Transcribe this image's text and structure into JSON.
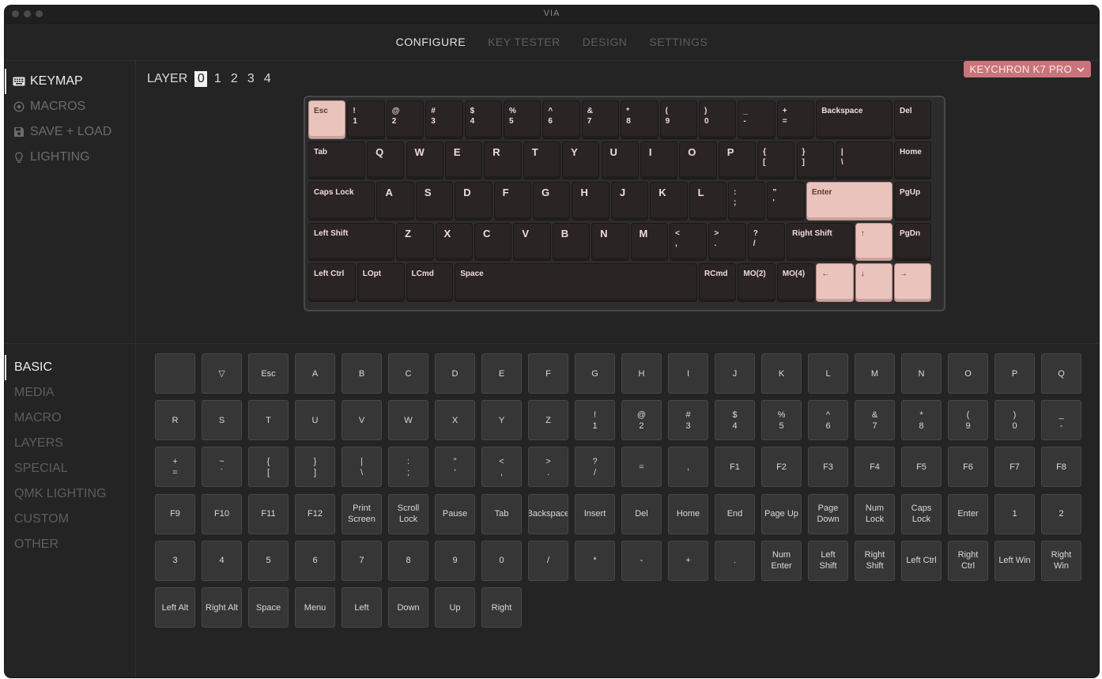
{
  "window": {
    "title": "VIA"
  },
  "nav": {
    "tabs": [
      "CONFIGURE",
      "KEY TESTER",
      "DESIGN",
      "SETTINGS"
    ],
    "active": 0
  },
  "sidebar": {
    "menu": [
      {
        "label": "KEYMAP",
        "icon": "keyboard-icon",
        "active": true
      },
      {
        "label": "MACROS",
        "icon": "circle-dot-icon",
        "active": false
      },
      {
        "label": "SAVE + LOAD",
        "icon": "floppy-icon",
        "active": false
      },
      {
        "label": "LIGHTING",
        "icon": "bulb-icon",
        "active": false
      }
    ],
    "categories": [
      "BASIC",
      "MEDIA",
      "MACRO",
      "LAYERS",
      "SPECIAL",
      "QMK LIGHTING",
      "CUSTOM",
      "OTHER"
    ]
  },
  "layers": {
    "label": "LAYER",
    "items": [
      "0",
      "1",
      "2",
      "3",
      "4"
    ],
    "active": 0
  },
  "keyboard_select": {
    "label": "KEYCHRON K7 PRO"
  },
  "colors": {
    "accent": "#c9747a",
    "keycap": "#2a2424",
    "keycap_accent": "#e9c3bc"
  },
  "keyboard": {
    "rows": [
      [
        "Esc",
        "!\n1",
        "@\n2",
        "#\n3",
        "$\n4",
        "%\n5",
        "^\n6",
        "&\n7",
        "*\n8",
        "(\n9",
        ")\n0",
        "_\n-",
        "+\n=",
        "Backspace",
        "Del"
      ],
      [
        "Tab",
        "Q",
        "W",
        "E",
        "R",
        "T",
        "Y",
        "U",
        "I",
        "O",
        "P",
        "{\n[",
        "}\n]",
        "|\n\\",
        "Home"
      ],
      [
        "Caps Lock",
        "A",
        "S",
        "D",
        "F",
        "G",
        "H",
        "J",
        "K",
        "L",
        ":\n;",
        "\"\n'",
        "Enter",
        "PgUp"
      ],
      [
        "Left Shift",
        "Z",
        "X",
        "C",
        "V",
        "B",
        "N",
        "M",
        "<\n,",
        ">\n.",
        "?\n/",
        "Right Shift",
        "↑",
        "PgDn"
      ],
      [
        "Left Ctrl",
        "LOpt",
        "LCmd",
        "Space",
        "RCmd",
        "MO(2)",
        "MO(4)",
        "←",
        "↓",
        "→"
      ]
    ]
  },
  "picker": {
    "keys": [
      "",
      "▽",
      "Esc",
      "A",
      "B",
      "C",
      "D",
      "E",
      "F",
      "G",
      "H",
      "I",
      "J",
      "K",
      "L",
      "M",
      "N",
      "O",
      "P",
      "Q",
      "R",
      "S",
      "T",
      "U",
      "V",
      "W",
      "X",
      "Y",
      "Z",
      "!\n1",
      "@\n2",
      "#\n3",
      "$\n4",
      "%\n5",
      "^\n6",
      "&\n7",
      "*\n8",
      "(\n9",
      ")\n0",
      "_\n-",
      "+\n=",
      "~\n`",
      "{\n[",
      "}\n]",
      "|\n\\",
      ":\n;",
      "\"\n'",
      "<\n,",
      ">\n.",
      "?\n/",
      "=",
      ",",
      "F1",
      "F2",
      "F3",
      "F4",
      "F5",
      "F6",
      "F7",
      "F8",
      "F9",
      "F10",
      "F11",
      "F12",
      "Print\nScreen",
      "Scroll\nLock",
      "Pause",
      "Tab",
      "Backspace",
      "Insert",
      "Del",
      "Home",
      "End",
      "Page Up",
      "Page\nDown",
      "Num\nLock",
      "Caps\nLock",
      "Enter",
      "1",
      "2",
      "3",
      "4",
      "5",
      "6",
      "7",
      "8",
      "9",
      "0",
      "/",
      "*",
      "-",
      "+",
      ".",
      "Num\nEnter",
      "Left\nShift",
      "Right\nShift",
      "Left Ctrl",
      "Right\nCtrl",
      "Left Win",
      "Right\nWin",
      "Left Alt",
      "Right Alt",
      "Space",
      "Menu",
      "Left",
      "Down",
      "Up",
      "Right"
    ]
  }
}
